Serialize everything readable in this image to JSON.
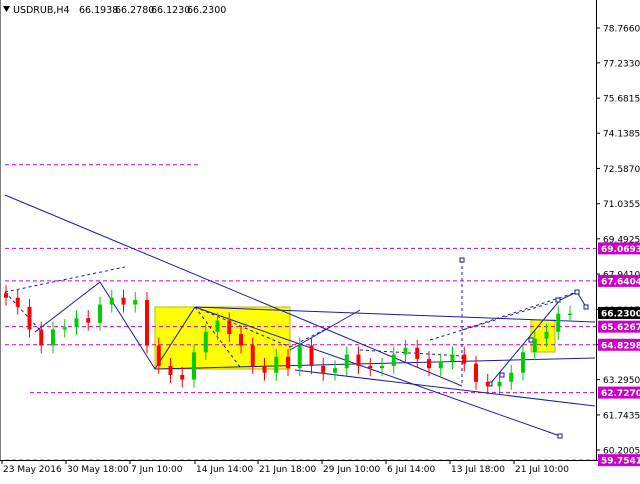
{
  "header": {
    "symbol": "USDRUB,H4",
    "open": "66.1938",
    "high": "66.2780",
    "low": "66.1230",
    "close": "66.2300"
  },
  "colors": {
    "background": "#ffffff",
    "frame": "#000000",
    "bull_candle": "#00cc00",
    "bear_candle": "#ff0000",
    "trend_line": "#1a1aa6",
    "level_line": "#cc00cc",
    "highlight_box": "#ffff00",
    "current_price_label": "#000000",
    "level_label": "#cc00cc"
  },
  "chart_data": {
    "type": "candlestick",
    "title": "",
    "xlabel": "",
    "ylabel": "",
    "ylim": [
      59.1,
      80.0
    ],
    "y_ticks": [
      "78.7660",
      "77.2330",
      "75.6815",
      "74.1385",
      "72.5870",
      "71.0355",
      "69.4925",
      "67.9410",
      "66.3895",
      "64.8380",
      "63.2950",
      "61.7435",
      "60.2005"
    ],
    "x_ticks": [
      "23 May 2016",
      "30 May 18:00",
      "7 Jun 10:00",
      "14 Jun 14:00",
      "21 Jun 18:00",
      "29 Jun 10:00",
      "6 Jul 14:00",
      "13 Jul 18:00",
      "21 Jul 10:00"
    ],
    "price_labels": [
      {
        "value": "69.0693",
        "role": "level"
      },
      {
        "value": "67.6404",
        "role": "level"
      },
      {
        "value": "66.2300",
        "role": "current"
      },
      {
        "value": "65.6267",
        "role": "level"
      },
      {
        "value": "64.8298",
        "role": "level"
      },
      {
        "value": "62.7270",
        "role": "level"
      },
      {
        "value": "59.7541",
        "role": "level"
      }
    ],
    "horizontal_levels": [
      72.75,
      69.0693,
      67.6404,
      65.6267,
      64.8298,
      62.727,
      59.7541
    ],
    "candles_close_path": [
      66.9,
      66.5,
      65.5,
      64.8,
      65.5,
      65.6,
      66.0,
      65.8,
      66.6,
      66.9,
      66.6,
      66.8,
      64.8,
      63.9,
      63.5,
      63.3,
      64.5,
      65.4,
      65.9,
      65.3,
      64.8,
      63.9,
      63.6,
      64.3,
      63.8,
      64.8,
      63.9,
      63.6,
      63.8,
      64.4,
      63.9,
      63.8,
      63.9,
      64.4,
      64.7,
      64.2,
      63.8,
      64.1,
      64.4,
      64.0,
      63.2,
      63.0,
      63.2,
      63.6,
      64.5,
      65.1,
      65.4,
      66.2,
      66.2
    ]
  }
}
